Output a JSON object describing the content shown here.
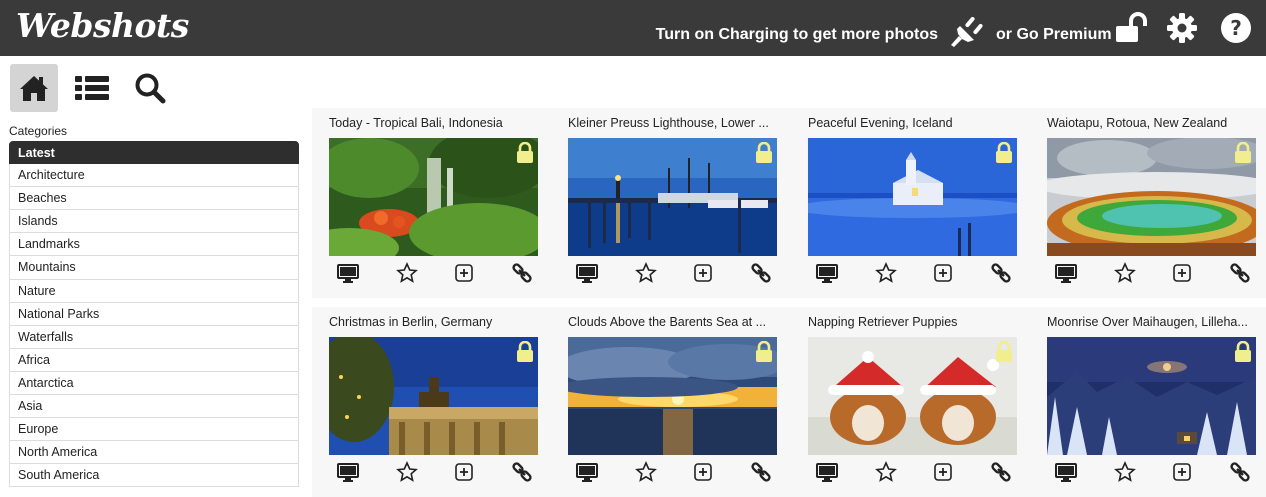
{
  "app": {
    "logo": "Webshots"
  },
  "header": {
    "promo_text": "Turn on Charging to get more photos",
    "premium_text": "or Go Premium",
    "icons": [
      "plug-icon",
      "unlock-icon",
      "gear-icon",
      "help-icon"
    ]
  },
  "nav": {
    "icons": [
      "home-icon",
      "list-icon",
      "search-icon"
    ],
    "active": "home-icon"
  },
  "categories": {
    "title": "Categories",
    "items": [
      "Latest",
      "Architecture",
      "Beaches",
      "Islands",
      "Landmarks",
      "Mountains",
      "Nature",
      "National Parks",
      "Waterfalls",
      "Africa",
      "Antarctica",
      "Asia",
      "Europe",
      "North America",
      "South America"
    ],
    "active": "Latest"
  },
  "photos": [
    {
      "title": "Today - Tropical Bali, Indonesia"
    },
    {
      "title": "Kleiner Preuss Lighthouse, Lower ..."
    },
    {
      "title": "Peaceful Evening, Iceland"
    },
    {
      "title": "Waiotapu, Rotoua, New Zealand"
    },
    {
      "title": "Christmas in Berlin, Germany"
    },
    {
      "title": "Clouds Above the Barents Sea at ..."
    },
    {
      "title": "Napping Retriever Puppies"
    },
    {
      "title": "Moonrise Over Maihaugen, Lilleha..."
    }
  ],
  "photo_actions": [
    "desktop-icon",
    "star-icon",
    "add-icon",
    "link-icon"
  ],
  "colors": {
    "topbar": "#3a3a3a",
    "lock": "#f1ee8e",
    "active_category": "#2e2e2e"
  }
}
